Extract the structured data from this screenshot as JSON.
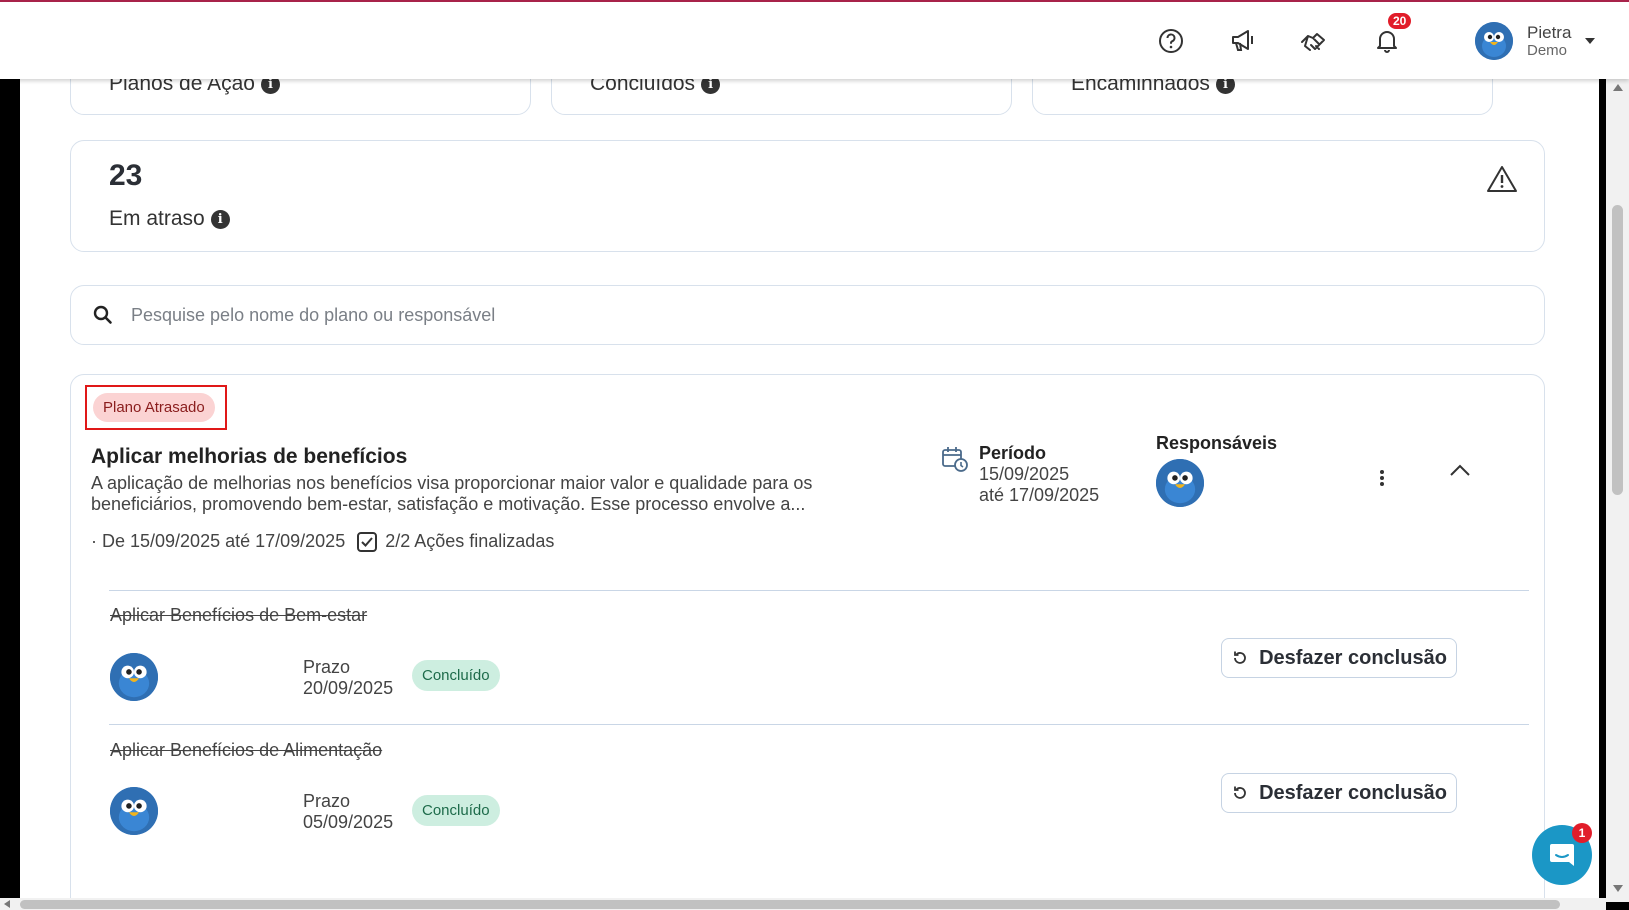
{
  "header": {
    "notification_count": "20",
    "user": {
      "name": "Pietra",
      "subtitle": "Demo"
    },
    "icons": [
      "help-icon",
      "megaphone-icon",
      "handshake-icon",
      "bell-icon"
    ]
  },
  "stats": {
    "planos_label": "Planos de Ação",
    "concluidos_label": "Concluídos",
    "encaminhados_label": "Encaminhados",
    "atraso_value": "23",
    "atraso_label": "Em atraso"
  },
  "search": {
    "placeholder": "Pesquise pelo nome do plano ou responsável"
  },
  "plan": {
    "status_badge": "Plano Atrasado",
    "title": "Aplicar melhorias de benefícios",
    "description_line1": "A aplicação de melhorias nos benefícios visa proporcionar maior valor e qualidade para os",
    "description_line2": "beneficiários, promovendo bem-estar, satisfação e motivação. Esse processo envolve a...",
    "date_range": "· De 15/09/2025 até 17/09/2025",
    "actions_done": "2/2 Ações finalizadas",
    "periodo_label": "Período",
    "periodo_start": "15/09/2025",
    "periodo_end": "até 17/09/2025",
    "responsaveis_label": "Responsáveis",
    "actions": [
      {
        "title": "Aplicar Benefícios de Bem-estar",
        "prazo_label": "Prazo",
        "prazo_date": "20/09/2025",
        "status": "Concluído",
        "button": "Desfazer conclusão"
      },
      {
        "title": "Aplicar Benefícios de Alimentação",
        "prazo_label": "Prazo",
        "prazo_date": "05/09/2025",
        "status": "Concluído",
        "button": "Desfazer conclusão"
      }
    ]
  },
  "chat": {
    "badge": "1"
  },
  "colors": {
    "accent_top": "#a8234a",
    "badge_red": "#e11d2a",
    "pill_red_bg": "#fbd3d3",
    "pill_green_bg": "#cdeee0",
    "chat_blue": "#1b97c6"
  }
}
